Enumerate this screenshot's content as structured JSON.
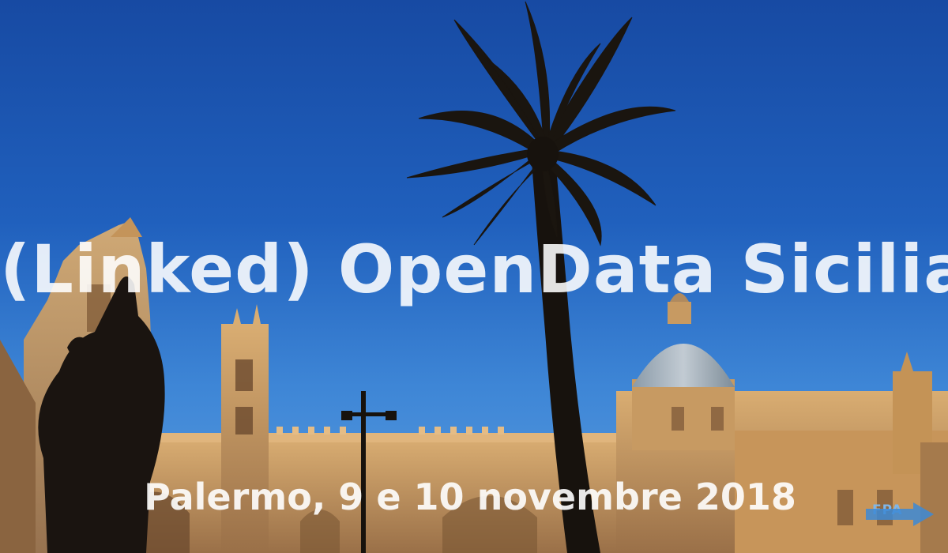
{
  "video_frame": {
    "title": "(Linked) OpenData Sicilia",
    "subtitle": "Palermo, 9 e 10 novembre 2018",
    "logo_text": "FPA"
  },
  "colors": {
    "sky_top": "#174aa3",
    "sky_bottom": "#5b9de0",
    "stone": "#c99a5e",
    "silhouette": "#1a1410",
    "text": "#ffffff"
  }
}
